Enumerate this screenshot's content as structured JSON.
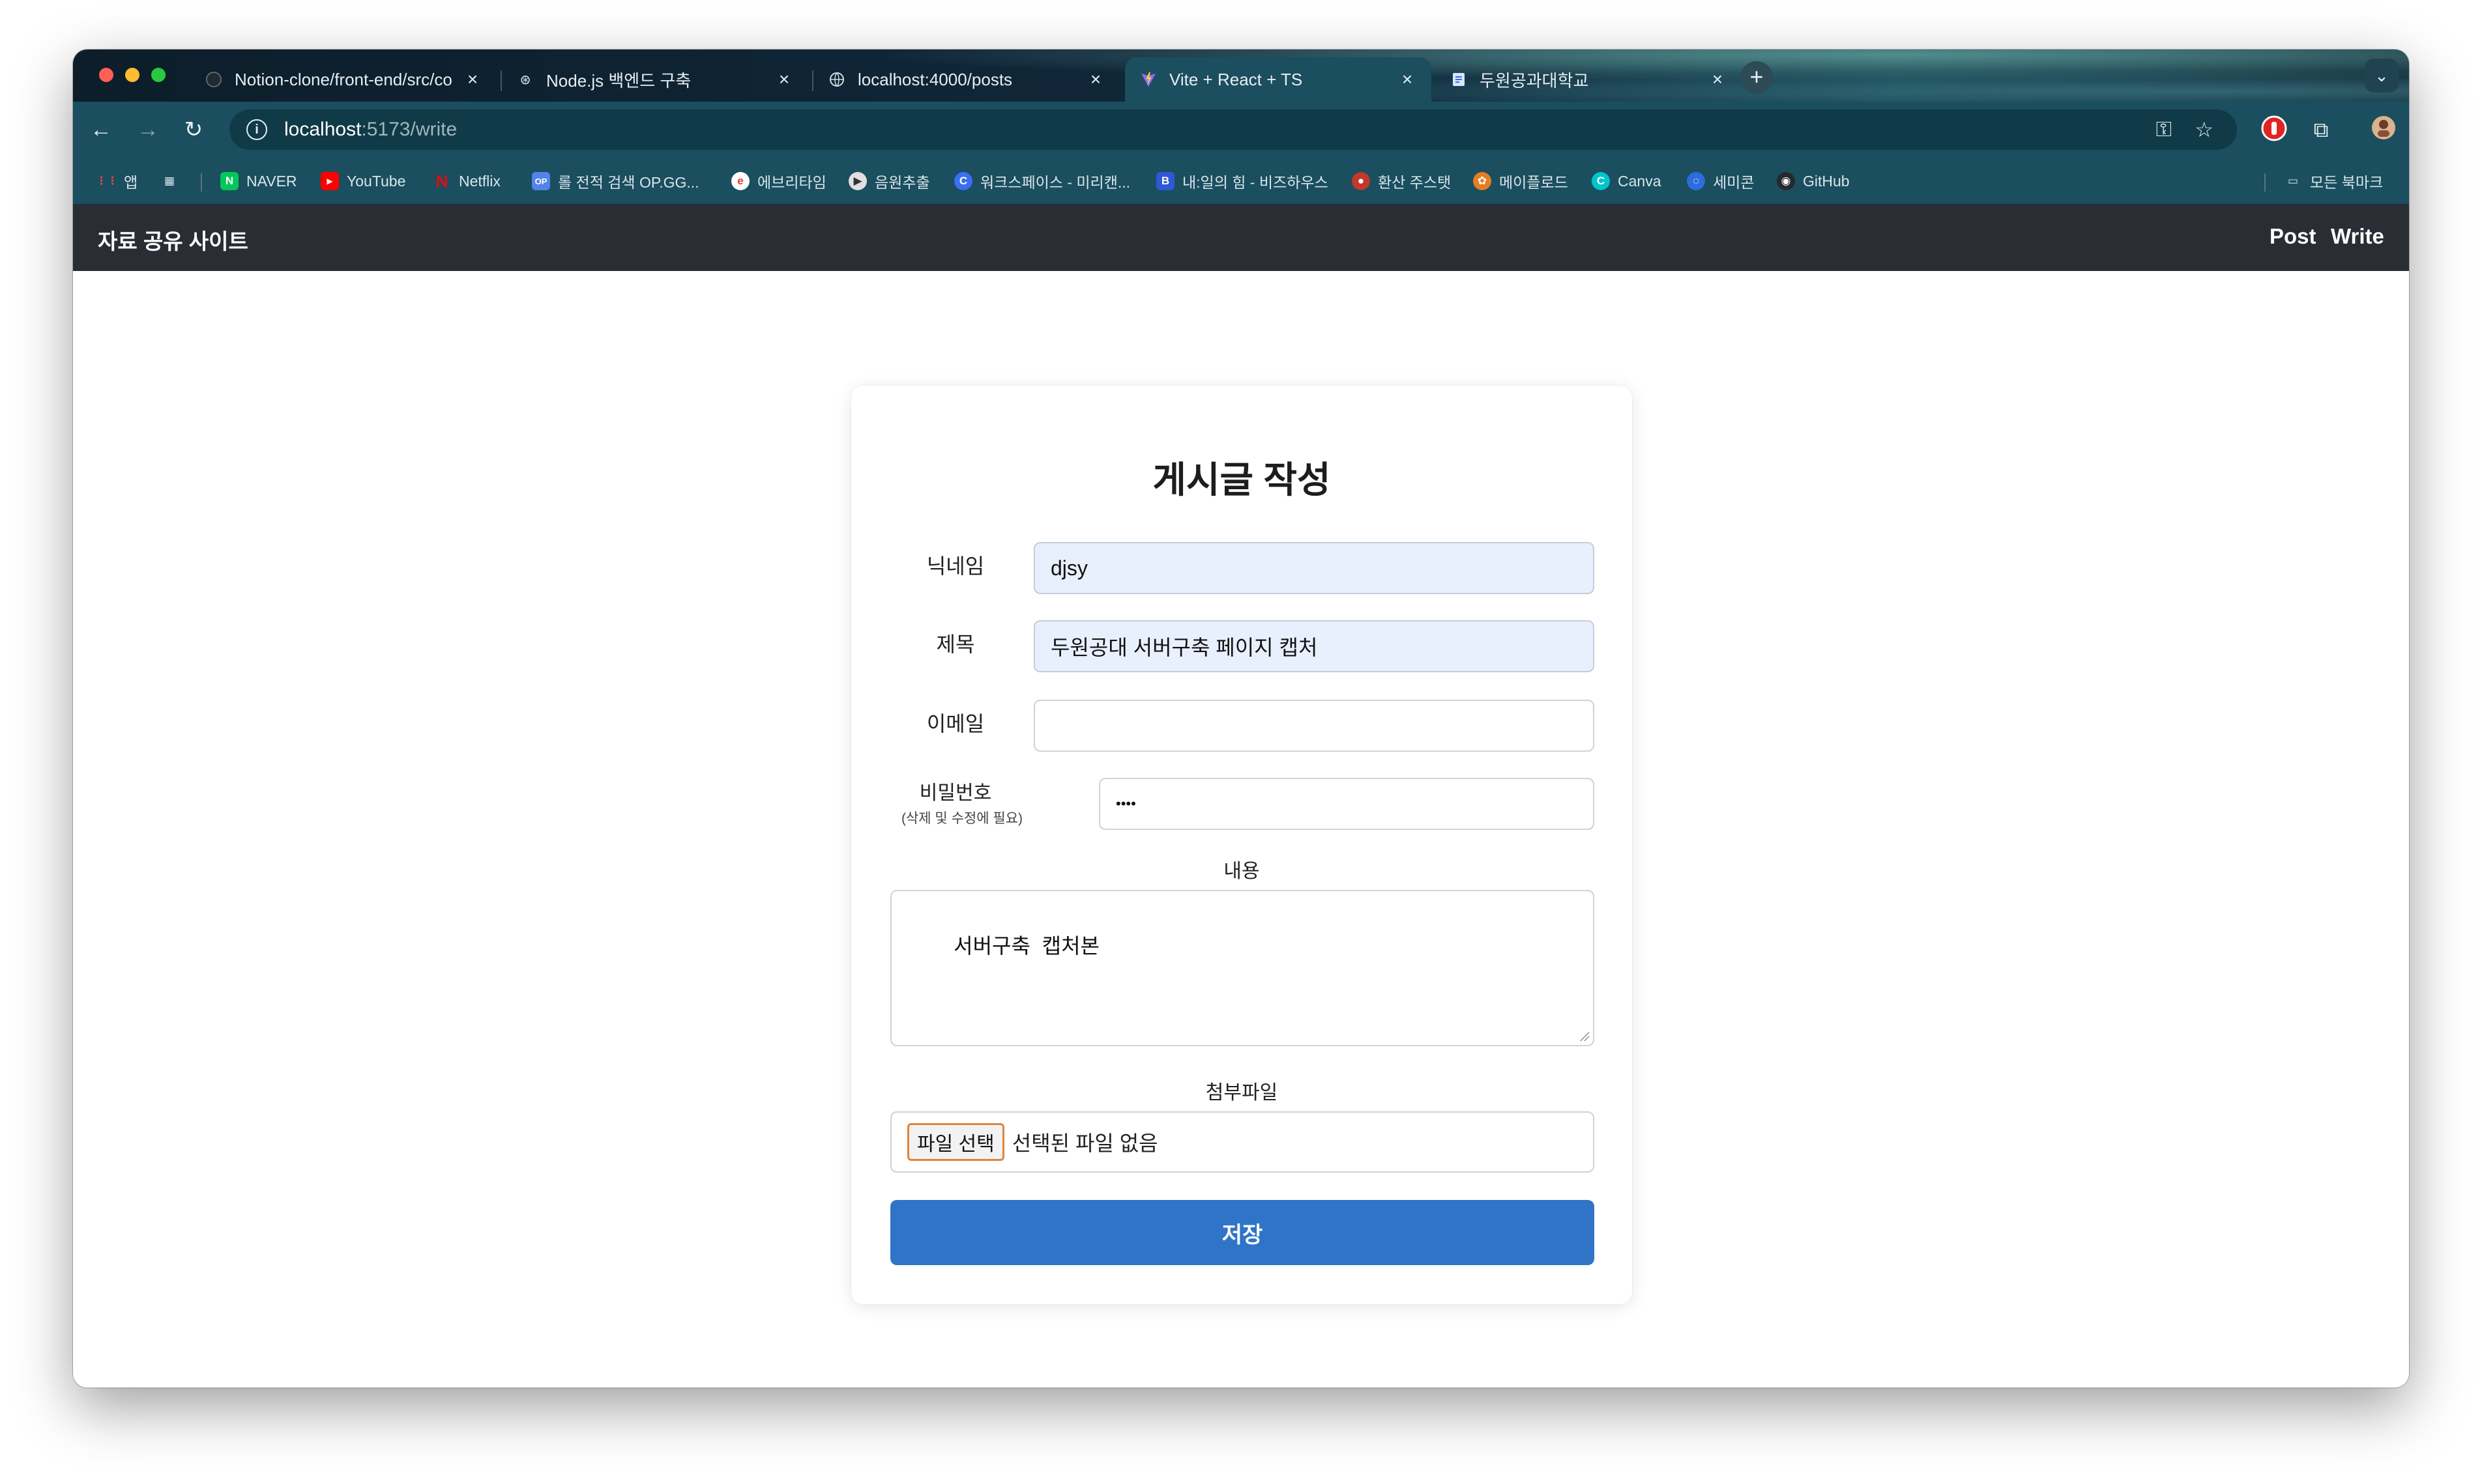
{
  "browser": {
    "tabs": [
      {
        "title": "Notion-clone/front-end/src/co",
        "favicon": "github-icon"
      },
      {
        "title": "Node.js 백엔드 구축",
        "favicon": "chatgpt-icon"
      },
      {
        "title": "localhost:4000/posts",
        "favicon": "globe-icon"
      },
      {
        "title": "Vite + React + TS",
        "favicon": "vite-icon"
      },
      {
        "title": "두원공과대학교",
        "favicon": "document-icon"
      }
    ],
    "new_tab_label": "+",
    "tab_search_icon": "chevron-down-icon",
    "address": {
      "host": "localhost",
      "path": ":5173/write"
    },
    "bookmarks": [
      {
        "label": "앱",
        "icon": "apps-icon"
      },
      {
        "label": "",
        "icon": "grid-icon"
      },
      {
        "label": "NAVER",
        "icon": "naver-icon",
        "color": "#03c75a"
      },
      {
        "label": "YouTube",
        "icon": "youtube-icon",
        "color": "#ff0000"
      },
      {
        "label": "Netflix",
        "icon": "netflix-icon",
        "color": "#e50914"
      },
      {
        "label": "롤 전적 검색 OP.GG...",
        "icon": "opgg-icon",
        "color": "#5383e8"
      },
      {
        "label": "에브리타임",
        "icon": "everytime-icon",
        "color": "#ffffff"
      },
      {
        "label": "음원추출",
        "icon": "music-icon",
        "color": "#e0e0e0"
      },
      {
        "label": "워크스페이스 - 미리캔...",
        "icon": "miricanvas-icon",
        "color": "#3b6ef5"
      },
      {
        "label": "내:일의 힘 - 비즈하우스",
        "icon": "bizhows-icon",
        "color": "#3057d5"
      },
      {
        "label": "환산 주스탯",
        "icon": "stat-icon",
        "color": "#c0392b"
      },
      {
        "label": "메이플로드",
        "icon": "maple-icon",
        "color": "#e67e22"
      },
      {
        "label": "Canva",
        "icon": "canva-icon",
        "color": "#00c4cc"
      },
      {
        "label": "세미콘",
        "icon": "semicon-icon",
        "color": "#2d6cdf"
      },
      {
        "label": "GitHub",
        "icon": "github-icon",
        "color": "#24292e"
      }
    ],
    "all_bookmarks": "모든 북마크"
  },
  "app": {
    "brand": "자료 공유 사이트",
    "nav": {
      "post": "Post",
      "write": "Write"
    }
  },
  "form": {
    "title": "게시글 작성",
    "nickname": {
      "label": "닉네임",
      "value": "djsy"
    },
    "subject": {
      "label": "제목",
      "value": "두원공대 서버구축 페이지 캡처"
    },
    "email": {
      "label": "이메일",
      "value": ""
    },
    "password": {
      "label": "비밀번호",
      "hint": "(삭제 및 수정에 필요)",
      "value": "••••"
    },
    "content": {
      "label": "내용",
      "value": "서버구축  캡처본"
    },
    "attachment": {
      "label": "첨부파일",
      "button": "파일 선택",
      "status": "선택된 파일 없음"
    },
    "submit": "저장"
  }
}
